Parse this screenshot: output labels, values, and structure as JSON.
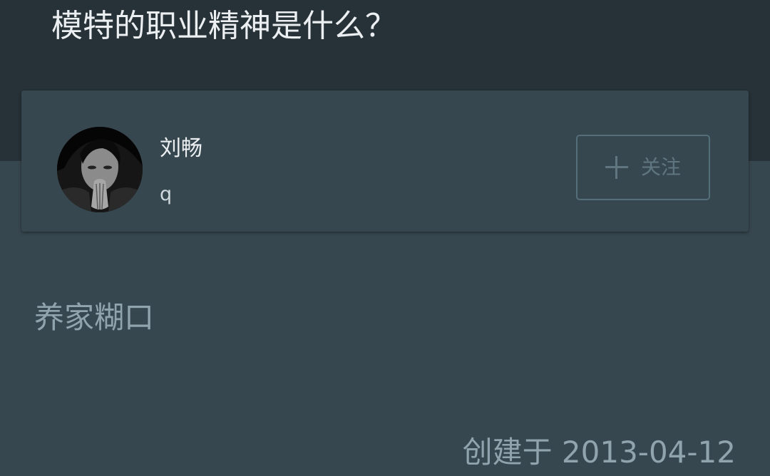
{
  "question": {
    "title": "模特的职业精神是什么？"
  },
  "author": {
    "avatar_icon": "avatar-photo",
    "name": "刘畅",
    "bio": "q",
    "follow_icon": "plus-icon",
    "follow_label": "关注"
  },
  "answer": {
    "content": "养家糊口",
    "created_at": "创建于 2013-04-12"
  },
  "colors": {
    "header_background": "#263238",
    "page_background": "#37474f",
    "primary_text": "#eceff1",
    "secondary_text": "#90a4ae",
    "button_border": "#546e7a"
  }
}
